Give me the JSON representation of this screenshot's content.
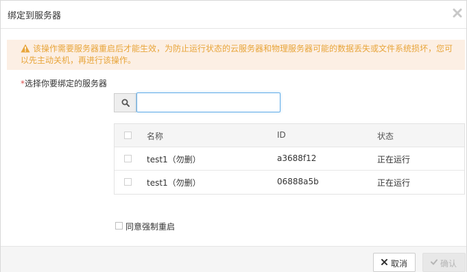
{
  "dialog": {
    "title": "绑定到服务器",
    "warning": "该操作需要服务器重启后才能生效，为防止运行状态的云服务器和物理服务器可能的数据丢失或文件系统损坏，您可以先主动关机，再进行该操作。",
    "select_label_star": "*",
    "select_label": "选择你要绑定的服务器",
    "search": {
      "value": "",
      "placeholder": ""
    },
    "table": {
      "headers": {
        "name": "名称",
        "id": "ID",
        "status": "状态"
      },
      "rows": [
        {
          "name": "test1（勿删）",
          "id": "a3688f12",
          "status": "正在运行"
        },
        {
          "name": "test1（勿删）",
          "id": "06888a5b",
          "status": "正在运行"
        }
      ]
    },
    "force_restart_label": "同意强制重启",
    "buttons": {
      "cancel": "取消",
      "confirm": "确认"
    }
  },
  "colors": {
    "warning_text": "#e8a53a",
    "warning_bg": "#fcefe4",
    "required_star": "#d9534f",
    "focus_border": "#66afe9"
  },
  "icons": {
    "close": "close-icon",
    "warning": "warning-icon",
    "search": "search-icon",
    "cancel": "x-icon",
    "confirm": "check-icon"
  }
}
